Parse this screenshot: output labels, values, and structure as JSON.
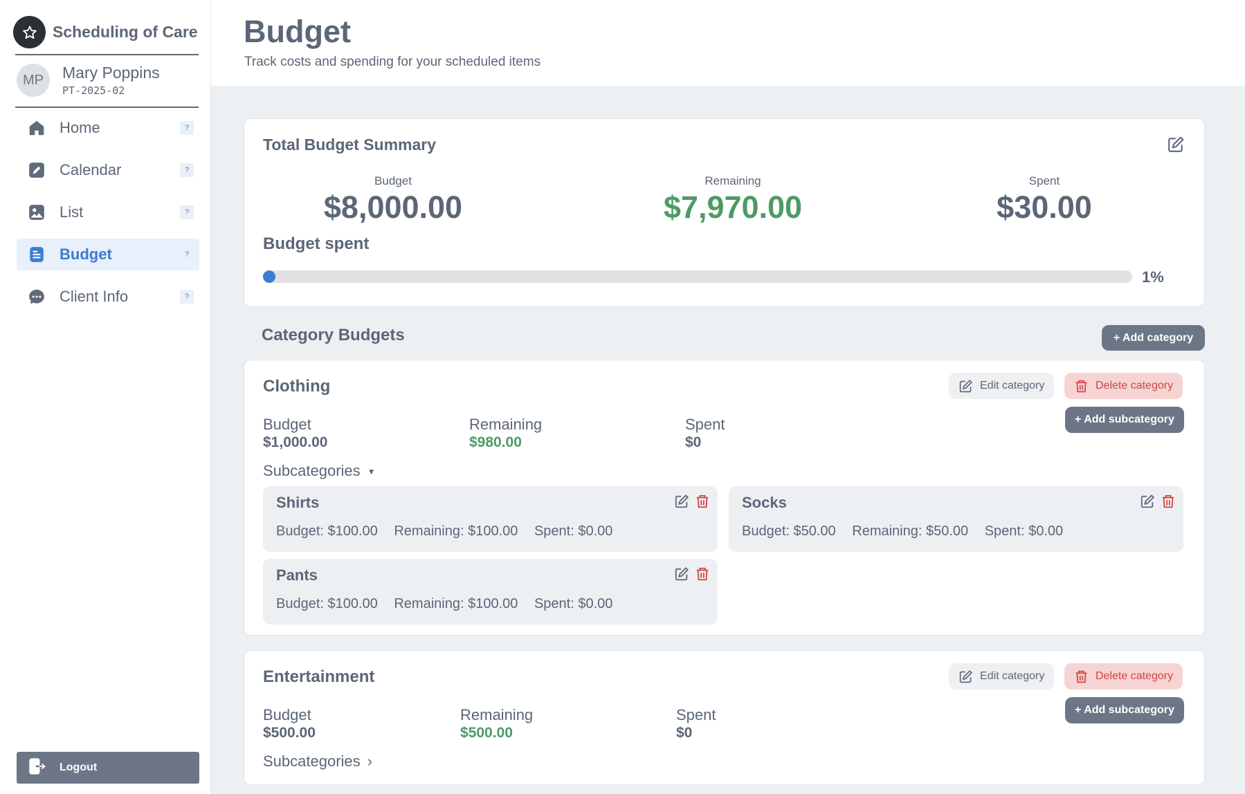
{
  "app": {
    "name": "Scheduling of Care"
  },
  "user": {
    "initials": "MP",
    "name": "Mary Poppins",
    "id": "PT-2025-02"
  },
  "nav": {
    "items": [
      {
        "label": "Home",
        "icon": "home-icon",
        "help": "?",
        "active": false
      },
      {
        "label": "Calendar",
        "icon": "pencil-square-icon",
        "help": "?",
        "active": false
      },
      {
        "label": "List",
        "icon": "image-icon",
        "help": "?",
        "active": false
      },
      {
        "label": "Budget",
        "icon": "document-icon",
        "help": "?",
        "active": true
      },
      {
        "label": "Client Info",
        "icon": "chat-bubble-icon",
        "help": "?",
        "active": false
      }
    ],
    "logout_label": "Logout"
  },
  "header": {
    "title": "Budget",
    "subtitle": "Track costs and spending for your scheduled items"
  },
  "summary": {
    "title": "Total Budget Summary",
    "budget_label": "Budget",
    "budget_value": "$8,000.00",
    "remaining_label": "Remaining",
    "remaining_value": "$7,970.00",
    "spent_label": "Spent",
    "spent_value": "$30.00",
    "progress_caption": "Budget spent",
    "progress_percent": 1,
    "progress_text": "1%"
  },
  "categories_section": {
    "title": "Category Budgets",
    "add_label": "+ Add category"
  },
  "categories": [
    {
      "name": "Clothing",
      "edit_label": "Edit category",
      "delete_label": "Delete category",
      "add_sub_label": "+ Add subcategory",
      "budget_label": "Budget",
      "budget": "$1,000.00",
      "remaining_label": "Remaining",
      "remaining": "$980.00",
      "spent_label": "Spent",
      "spent": "$0",
      "subcategories_label": "Subcategories",
      "expanded": true,
      "subcategories": [
        {
          "name": "Shirts",
          "budget": "Budget: $100.00",
          "remaining": "Remaining: $100.00",
          "spent": "Spent: $0.00"
        },
        {
          "name": "Socks",
          "budget": "Budget: $50.00",
          "remaining": "Remaining: $50.00",
          "spent": "Spent: $0.00"
        },
        {
          "name": "Pants",
          "budget": "Budget: $100.00",
          "remaining": "Remaining: $100.00",
          "spent": "Spent: $0.00"
        }
      ]
    },
    {
      "name": "Entertainment",
      "edit_label": "Edit category",
      "delete_label": "Delete category",
      "add_sub_label": "+ Add subcategory",
      "budget_label": "Budget",
      "budget": "$500.00",
      "remaining_label": "Remaining",
      "remaining": "$500.00",
      "spent_label": "Spent",
      "spent": "$0",
      "subcategories_label": "Subcategories",
      "expanded": false,
      "subcategories": []
    }
  ],
  "colors": {
    "accent": "#3b7dd1",
    "positive": "#4e9a67",
    "danger": "#d04444",
    "button_dark": "#6c7686"
  }
}
